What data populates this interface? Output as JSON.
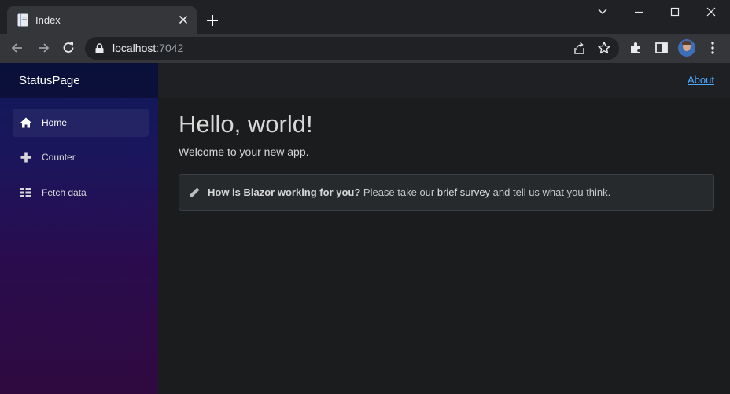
{
  "browser": {
    "tab_title": "Index",
    "url_host": "localhost",
    "url_port": ":7042"
  },
  "sidebar": {
    "brand": "StatusPage",
    "items": [
      {
        "label": "Home",
        "icon": "home-icon"
      },
      {
        "label": "Counter",
        "icon": "plus-icon"
      },
      {
        "label": "Fetch data",
        "icon": "list-icon"
      }
    ]
  },
  "topbar": {
    "about_label": "About"
  },
  "main": {
    "heading": "Hello, world!",
    "welcome": "Welcome to your new app.",
    "survey": {
      "bold": "How is Blazor working for you?",
      "prefix": " Please take our ",
      "link": "brief survey",
      "suffix": " and tell us what you think."
    }
  },
  "colors": {
    "link": "#4aa8ff",
    "sidebar_top": "#0e1a5a",
    "sidebar_bottom": "#2f0a3f"
  }
}
